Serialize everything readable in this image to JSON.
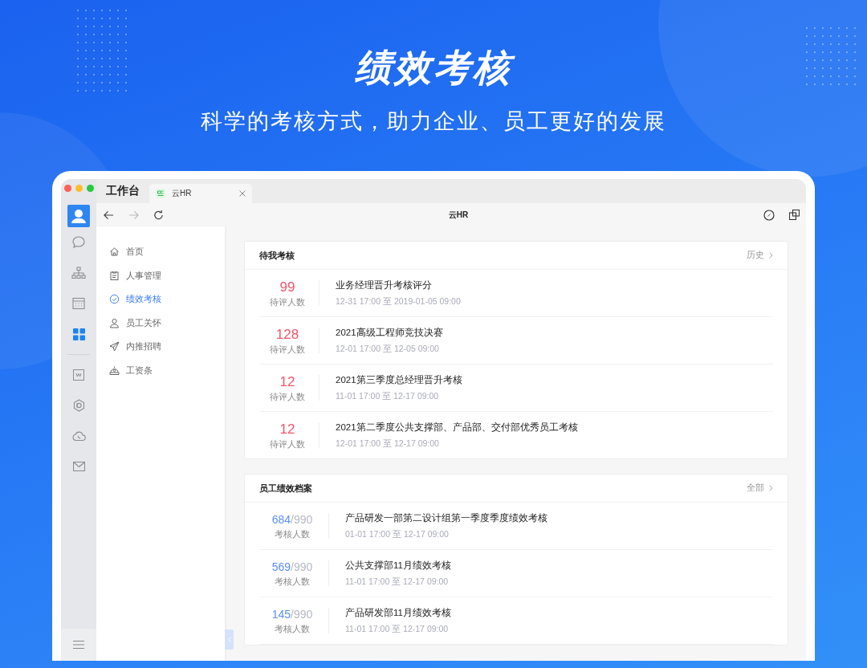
{
  "hero": {
    "title": "绩效考核",
    "subtitle": "科学的考核方式，助力企业、员工更好的发展"
  },
  "window": {
    "workspace_label": "工作台",
    "tab": {
      "title": "云HR"
    },
    "page_title": "云HR",
    "nav_buttons": [
      {
        "kind": "back",
        "disabled": false
      },
      {
        "kind": "forward",
        "disabled": true
      },
      {
        "kind": "reload",
        "disabled": false
      }
    ],
    "rail_top": [
      {
        "kind": "chat",
        "selected": false
      },
      {
        "kind": "org",
        "selected": false
      },
      {
        "kind": "calendar",
        "selected": false
      },
      {
        "kind": "apps",
        "selected": true
      }
    ],
    "rail_bottom": [
      {
        "kind": "doc",
        "selected": false
      },
      {
        "kind": "hex",
        "selected": false
      },
      {
        "kind": "cloud",
        "selected": false
      },
      {
        "kind": "mail",
        "selected": false
      }
    ]
  },
  "sidebar": {
    "items": [
      {
        "label": "首页",
        "kind": "home",
        "selected": false
      },
      {
        "label": "人事管理",
        "kind": "clipboard",
        "selected": false
      },
      {
        "label": "绩效考核",
        "kind": "check",
        "selected": true
      },
      {
        "label": "员工关怀",
        "kind": "person",
        "selected": false
      },
      {
        "label": "内推招聘",
        "kind": "send",
        "selected": false
      },
      {
        "label": "工资条",
        "kind": "wallet",
        "selected": false
      }
    ]
  },
  "pending": {
    "title": "待我考核",
    "link": "历史",
    "items": [
      {
        "count": "99",
        "count_label": "待评人数",
        "title": "业务经理晋升考核评分",
        "period": "12-31 17:00 至 2019-01-05 09:00"
      },
      {
        "count": "128",
        "count_label": "待评人数",
        "title": "2021高级工程师竞技决赛",
        "period": "12-01 17:00 至 12-05 09:00"
      },
      {
        "count": "12",
        "count_label": "待评人数",
        "title": "2021第三季度总经理晋升考核",
        "period": "11-01 17:00 至 12-17 09:00"
      },
      {
        "count": "12",
        "count_label": "待评人数",
        "title": "2021第二季度公共支撑部、产品部、交付部优秀员工考核",
        "period": "12-01 17:00 至 12-17 09:00"
      }
    ]
  },
  "archive": {
    "title": "员工绩效档案",
    "link": "全部",
    "items": [
      {
        "count": "684",
        "total": "/990",
        "count_label": "考核人数",
        "title": "产品研发一部第二设计组第一季度季度绩效考核",
        "period": "01-01 17:00 至 12-17 09:00"
      },
      {
        "count": "569",
        "total": "/990",
        "count_label": "考核人数",
        "title": "公共支撑部11月绩效考核",
        "period": "11-01 17:00 至 12-17 09:00"
      },
      {
        "count": "145",
        "total": "/990",
        "count_label": "考核人数",
        "title": "产品研发部11月绩效考核",
        "period": "11-01 17:00 至 12-17 09:00"
      }
    ]
  }
}
